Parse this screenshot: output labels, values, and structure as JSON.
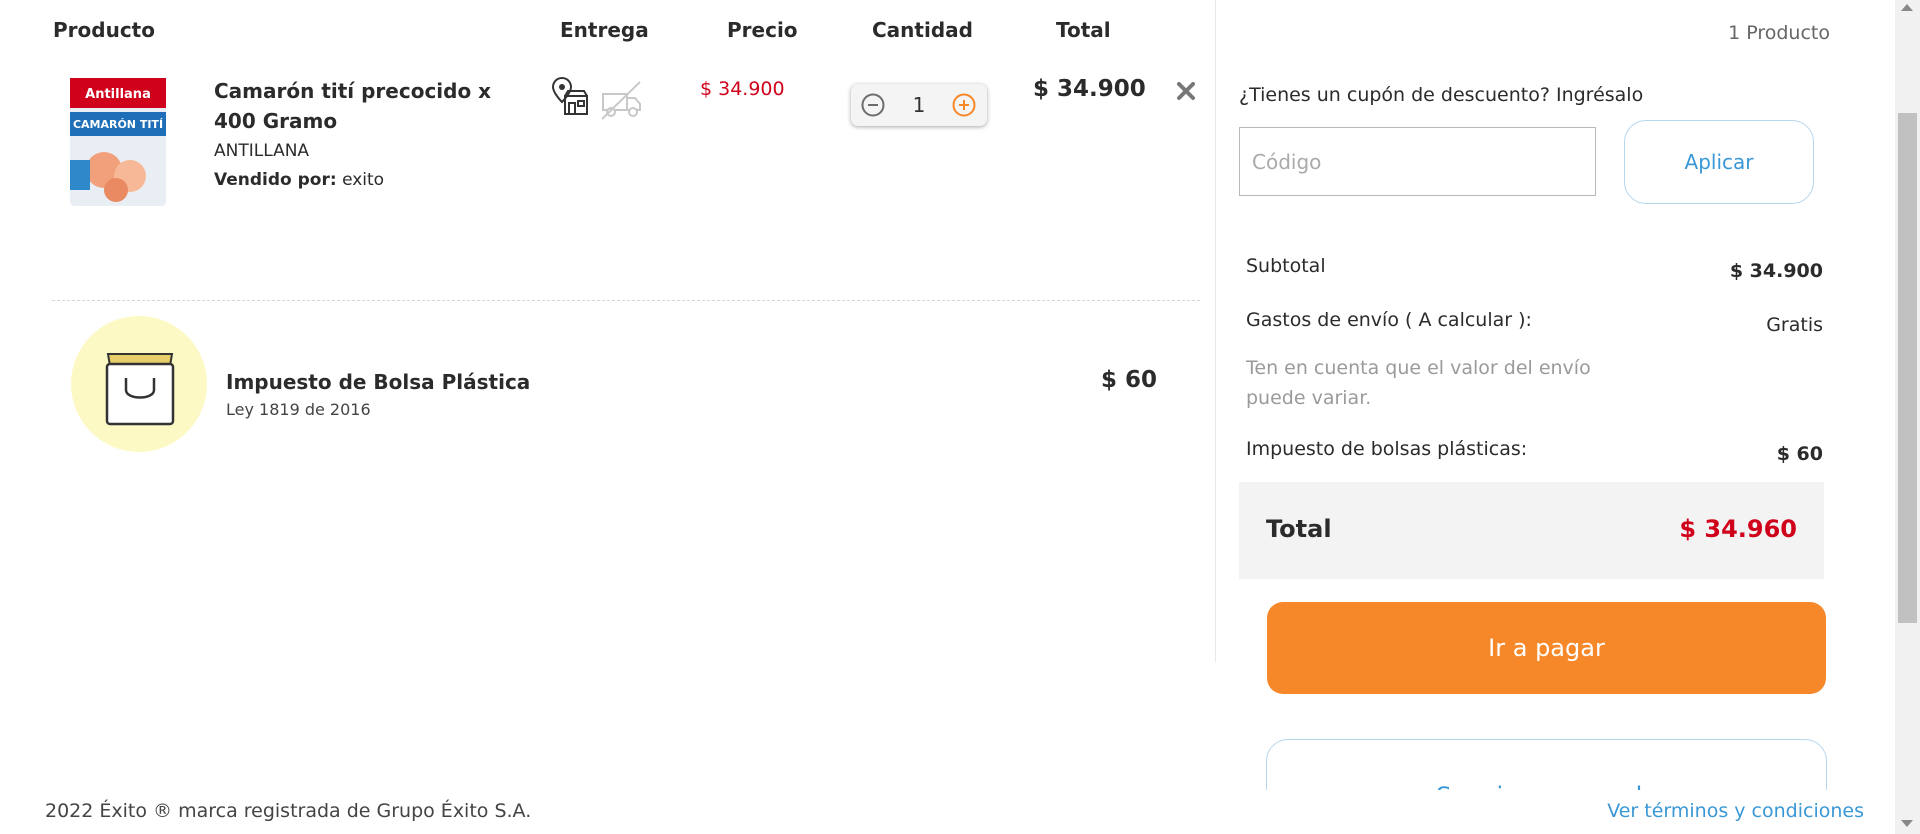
{
  "table": {
    "headers": {
      "product": "Producto",
      "delivery": "Entrega",
      "price": "Precio",
      "quantity": "Cantidad",
      "total": "Total"
    }
  },
  "cart_item": {
    "name": "Camarón tití precocido x 400 Gramo",
    "brand": "ANTILLANA",
    "seller_label": "Vendido por:",
    "seller": "exito",
    "price": "$ 34.900",
    "quantity": "1",
    "total": "$ 34.900",
    "image_brand_text": "Antillana",
    "image_product_text": "CAMARÓN TITÍ",
    "delivery_icons": [
      "store-pickup-icon",
      "home-delivery-disabled-icon"
    ]
  },
  "bag_tax": {
    "name": "Impuesto de Bolsa Plástica",
    "law": "Ley 1819 de 2016",
    "price": "$ 60"
  },
  "summary": {
    "product_count": "1 Producto",
    "coupon_question": "¿Tienes un cupón de descuento? Ingrésalo",
    "coupon_placeholder": "Código",
    "apply_label": "Aplicar",
    "subtotal_label": "Subtotal",
    "subtotal_value": "$ 34.900",
    "shipping_label": "Gastos de envío ( A calcular ):",
    "shipping_value": "Gratis",
    "shipping_note": "Ten en cuenta que el valor del envío puede variar.",
    "bag_tax_label": "Impuesto de bolsas plásticas:",
    "bag_tax_value": "$ 60",
    "total_label": "Total",
    "total_value": "$ 34.960",
    "pay_label": "Ir a pagar",
    "continue_label": "Seguir comprando"
  },
  "footer": {
    "copyright": "2022 Éxito ® marca registrada de Grupo Éxito S.A.",
    "terms_link": "Ver términos y condiciones"
  },
  "colors": {
    "accent_orange": "#f6882a",
    "price_red": "#d0021b",
    "link_blue": "#3a98d6",
    "bag_circle": "#fdf9c4"
  }
}
